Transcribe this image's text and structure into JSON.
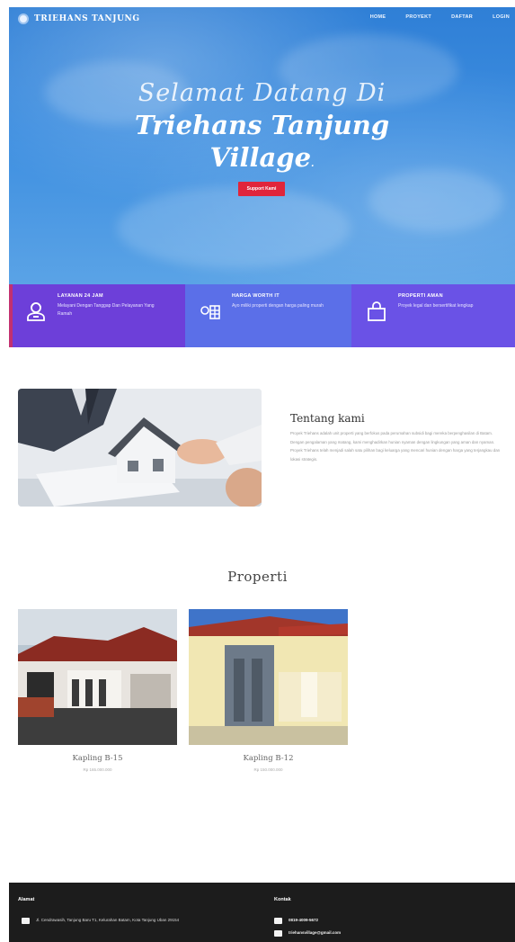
{
  "brand": {
    "name": "TRIEHANS TANJUNG"
  },
  "nav": {
    "items": [
      {
        "label": "HOME"
      },
      {
        "label": "PROYEKT"
      },
      {
        "label": "DAFTAR"
      },
      {
        "label": "LOGIN"
      }
    ]
  },
  "hero": {
    "line1": "Selamat Datang Di",
    "line2": "Triehans Tanjung",
    "line3": "Village",
    "cta": "Support Kami"
  },
  "features": [
    {
      "title": "LAYANAN 24 JAM",
      "desc": "Melayani Dengan Tanggap Dan Pelayanan Yang Ramah",
      "icon": "user-service-icon"
    },
    {
      "title": "HARGA WORTH IT",
      "desc": "Ayo miliki properti dengan harga paling murah",
      "icon": "price-tag-icon"
    },
    {
      "title": "PROPERTI AMAN",
      "desc": "Proyek legal dan bersertifikat lengkap",
      "icon": "shopping-bag-icon"
    }
  ],
  "about": {
    "title": "Tentang kami",
    "body": "Proyek Triehans adalah unit properti yang berfokus pada perumahan subsidi bagi mereka berpenghasilan di Batam. Dengan pengalaman yang matang, kami menghadirkan hunian nyaman dengan lingkungan yang aman dan nyaman. Proyek Triehans telah menjadi salah satu pilihan bagi keluarga yang mencari hunian dengan harga yang terjangkau dan lokasi strategis."
  },
  "properti": {
    "title": "Properti",
    "items": [
      {
        "name": "Kapling B-15",
        "price": "Rp 165.000.000"
      },
      {
        "name": "Kapling B-12",
        "price": "Rp 150.000.000"
      }
    ]
  },
  "footer": {
    "alamat_label": "Alamat",
    "alamat": "Jl. Cendrawasih, Tanjung Baru T1, Kelurahan Batam, Kota Tanjung Uban 29154",
    "kontak_label": "Kontak",
    "phone": "0819-4009-5672",
    "email": "triehansvillage@gmail.com"
  },
  "colors": {
    "hero_blue": "#3d8ee0",
    "cta_red": "#e0253b",
    "feature_purple": "#6d3fd9",
    "feature_blue": "#5b6fe8",
    "footer_bg": "#1c1c1c"
  }
}
